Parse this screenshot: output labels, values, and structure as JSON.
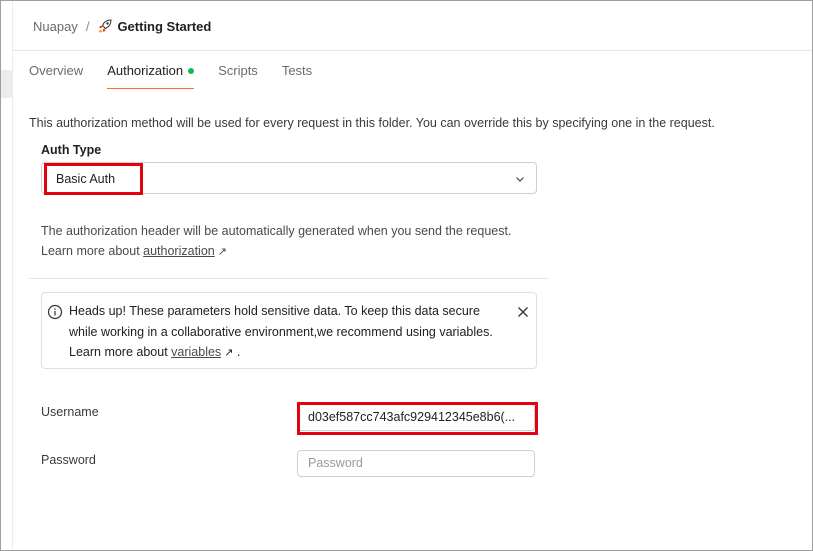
{
  "breadcrumb": {
    "parent": "Nuapay",
    "separator": "/",
    "title": "Getting Started",
    "icon": "rocket-icon"
  },
  "tabs": [
    {
      "label": "Overview",
      "active": false
    },
    {
      "label": "Authorization",
      "active": true,
      "indicator": "dot"
    },
    {
      "label": "Scripts",
      "active": false
    },
    {
      "label": "Tests",
      "active": false
    }
  ],
  "description": "This authorization method will be used for every request in this folder. You can override this by specifying one in the request.",
  "auth": {
    "label": "Auth Type",
    "selected": "Basic Auth"
  },
  "info": {
    "line1": "The authorization header will be automatically generated when you send the request.",
    "learn_prefix": "Learn more about ",
    "learn_link": "authorization"
  },
  "notice": {
    "line1": "Heads up! These parameters hold sensitive data. To keep this data secure",
    "line2": "while working in a collaborative environment,we recommend using variables.",
    "learn_prefix": "Learn more about ",
    "learn_link": "variables",
    "suffix": " ."
  },
  "fields": {
    "username_label": "Username",
    "username_value": "d03ef587cc743afc929412345e8b6(...",
    "password_label": "Password",
    "password_placeholder": "Password"
  },
  "colors": {
    "accent": "#ff6c37",
    "dot": "#0cbb52",
    "highlight": "#e3000f"
  }
}
